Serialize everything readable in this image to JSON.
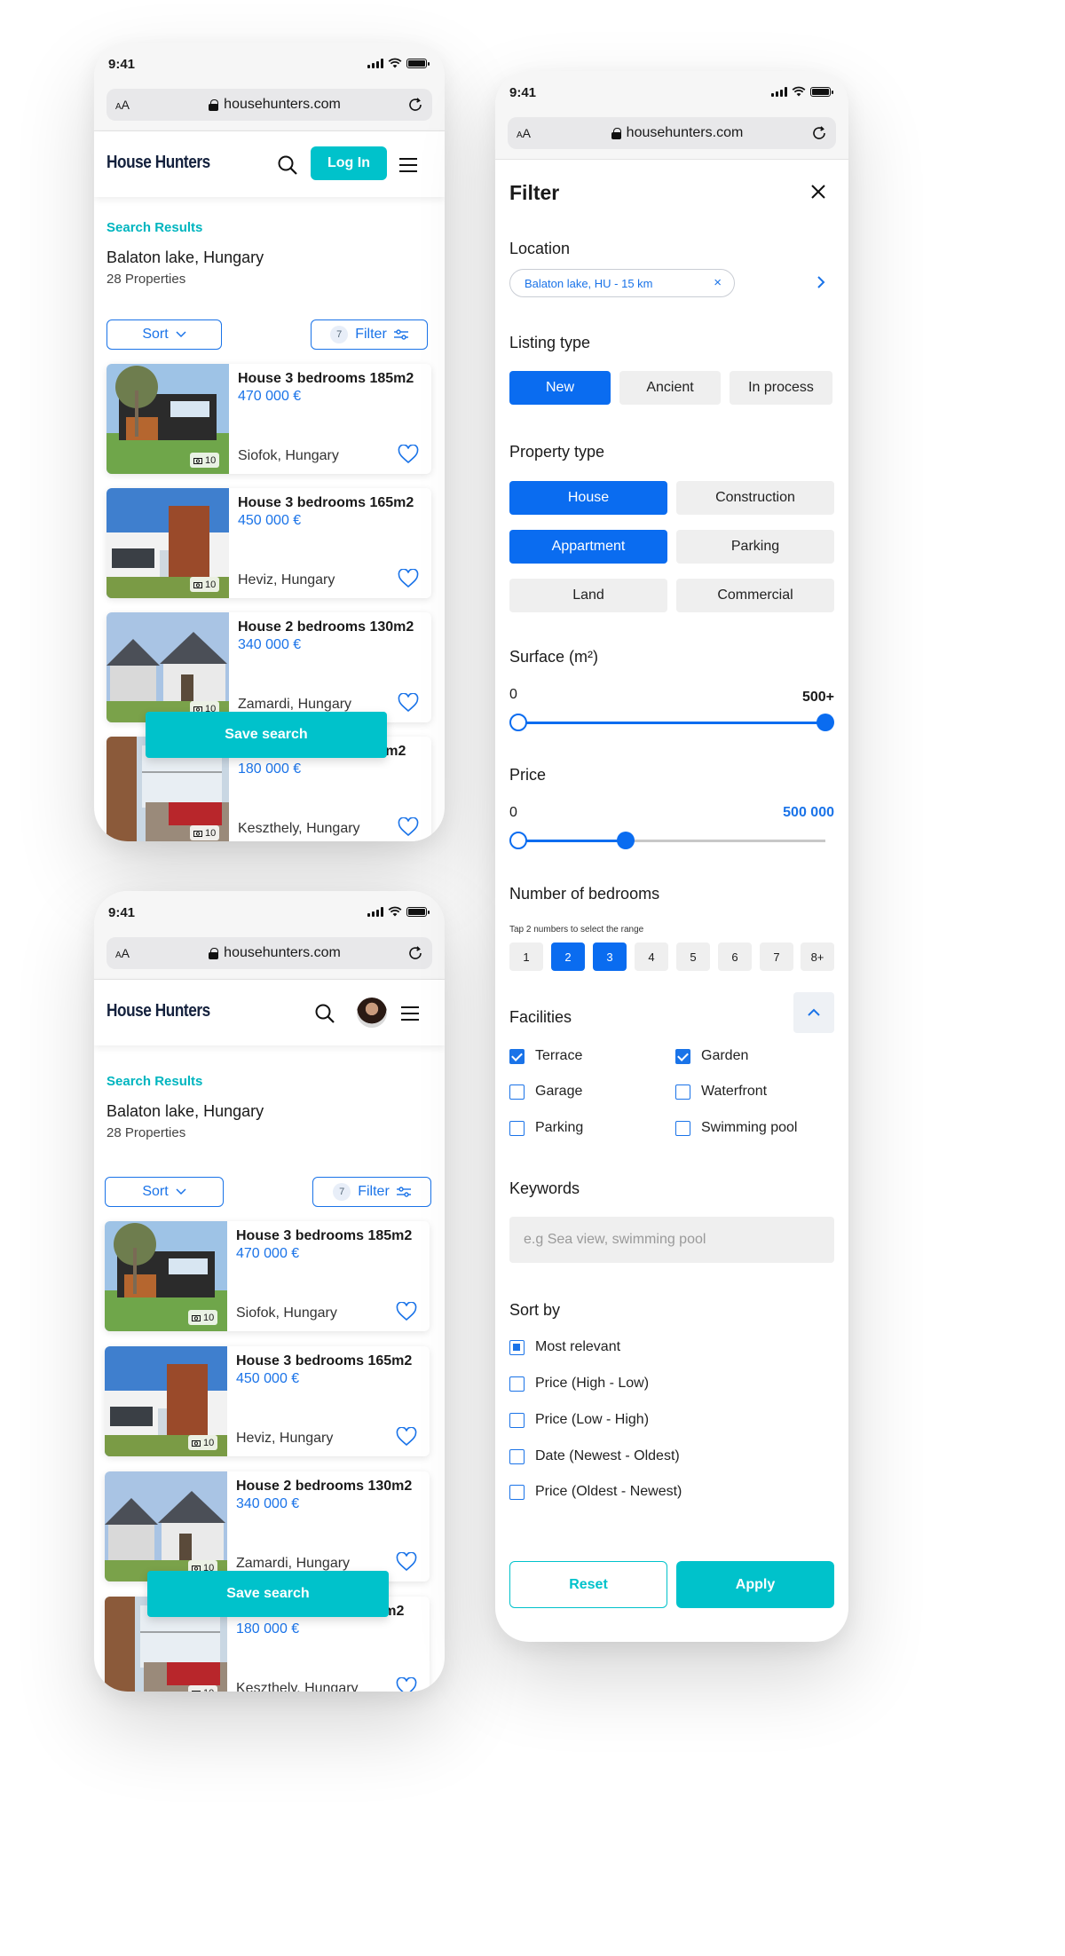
{
  "status": {
    "time": "9:41"
  },
  "browser": {
    "text_size": "AA",
    "url": "househunters.com"
  },
  "header": {
    "logo": "House Hunters",
    "login_label": "Log In"
  },
  "results": {
    "section_label": "Search Results",
    "location": "Balaton lake, Hungary",
    "count": "28 Properties",
    "sort_label": "Sort",
    "filter_label": "Filter",
    "filter_count": "7",
    "save_search_label": "Save search",
    "listings": [
      {
        "title": "House 3 bedrooms 185m2",
        "price": "470 000 €",
        "location": "Siofok, Hungary",
        "photos": "10"
      },
      {
        "title": "House 3 bedrooms 165m2",
        "price": "450 000 €",
        "location": "Heviz, Hungary",
        "photos": "10"
      },
      {
        "title": "House 2 bedrooms 130m2",
        "price": "340 000 €",
        "location": "Zamardi, Hungary",
        "photos": "10"
      },
      {
        "title": "House 2 bedrooms 80m2",
        "price": "180 000 €",
        "location": "Keszthely, Hungary",
        "photos": "10"
      }
    ]
  },
  "filter": {
    "title": "Filter",
    "location_label": "Location",
    "location_chip": "Balaton lake, HU - 15 km",
    "listing_type_label": "Listing type",
    "listing_types": [
      {
        "label": "New",
        "selected": true
      },
      {
        "label": "Ancient",
        "selected": false
      },
      {
        "label": "In process",
        "selected": false
      }
    ],
    "property_type_label": "Property type",
    "property_types": [
      {
        "label": "House",
        "selected": true
      },
      {
        "label": "Construction",
        "selected": false
      },
      {
        "label": "Appartment",
        "selected": true
      },
      {
        "label": "Parking",
        "selected": false
      },
      {
        "label": "Land",
        "selected": false
      },
      {
        "label": "Commercial",
        "selected": false
      }
    ],
    "surface_label": "Surface (m²)",
    "surface_min": "0",
    "surface_max": "500+",
    "surface_range": [
      0,
      1
    ],
    "price_label": "Price",
    "price_min": "0",
    "price_max": "500 000",
    "price_range": [
      0,
      0.35
    ],
    "bedrooms_label": "Number of bedrooms",
    "bedrooms_hint": "Tap 2 numbers to select the range",
    "bedrooms": [
      {
        "label": "1",
        "selected": false
      },
      {
        "label": "2",
        "selected": true
      },
      {
        "label": "3",
        "selected": true
      },
      {
        "label": "4",
        "selected": false
      },
      {
        "label": "5",
        "selected": false
      },
      {
        "label": "6",
        "selected": false
      },
      {
        "label": "7",
        "selected": false
      },
      {
        "label": "8+",
        "selected": false
      }
    ],
    "facilities_label": "Facilities",
    "facilities": [
      {
        "label": "Terrace",
        "checked": true
      },
      {
        "label": "Garden",
        "checked": true
      },
      {
        "label": "Garage",
        "checked": false
      },
      {
        "label": "Waterfront",
        "checked": false
      },
      {
        "label": "Parking",
        "checked": false
      },
      {
        "label": "Swimming pool",
        "checked": false
      }
    ],
    "keywords_label": "Keywords",
    "keywords_placeholder": "e.g Sea view, swimming pool",
    "sort_by_label": "Sort by",
    "sort_options": [
      {
        "label": "Most relevant",
        "selected": true
      },
      {
        "label": "Price (High - Low)",
        "selected": false
      },
      {
        "label": "Price (Low - High)",
        "selected": false
      },
      {
        "label": "Date (Newest - Oldest)",
        "selected": false
      },
      {
        "label": "Price (Oldest - Newest)",
        "selected": false
      }
    ],
    "reset_label": "Reset",
    "apply_label": "Apply"
  },
  "colors": {
    "accent": "#00c2cb",
    "primary": "#0a6cf0",
    "link": "#1a73e8"
  }
}
